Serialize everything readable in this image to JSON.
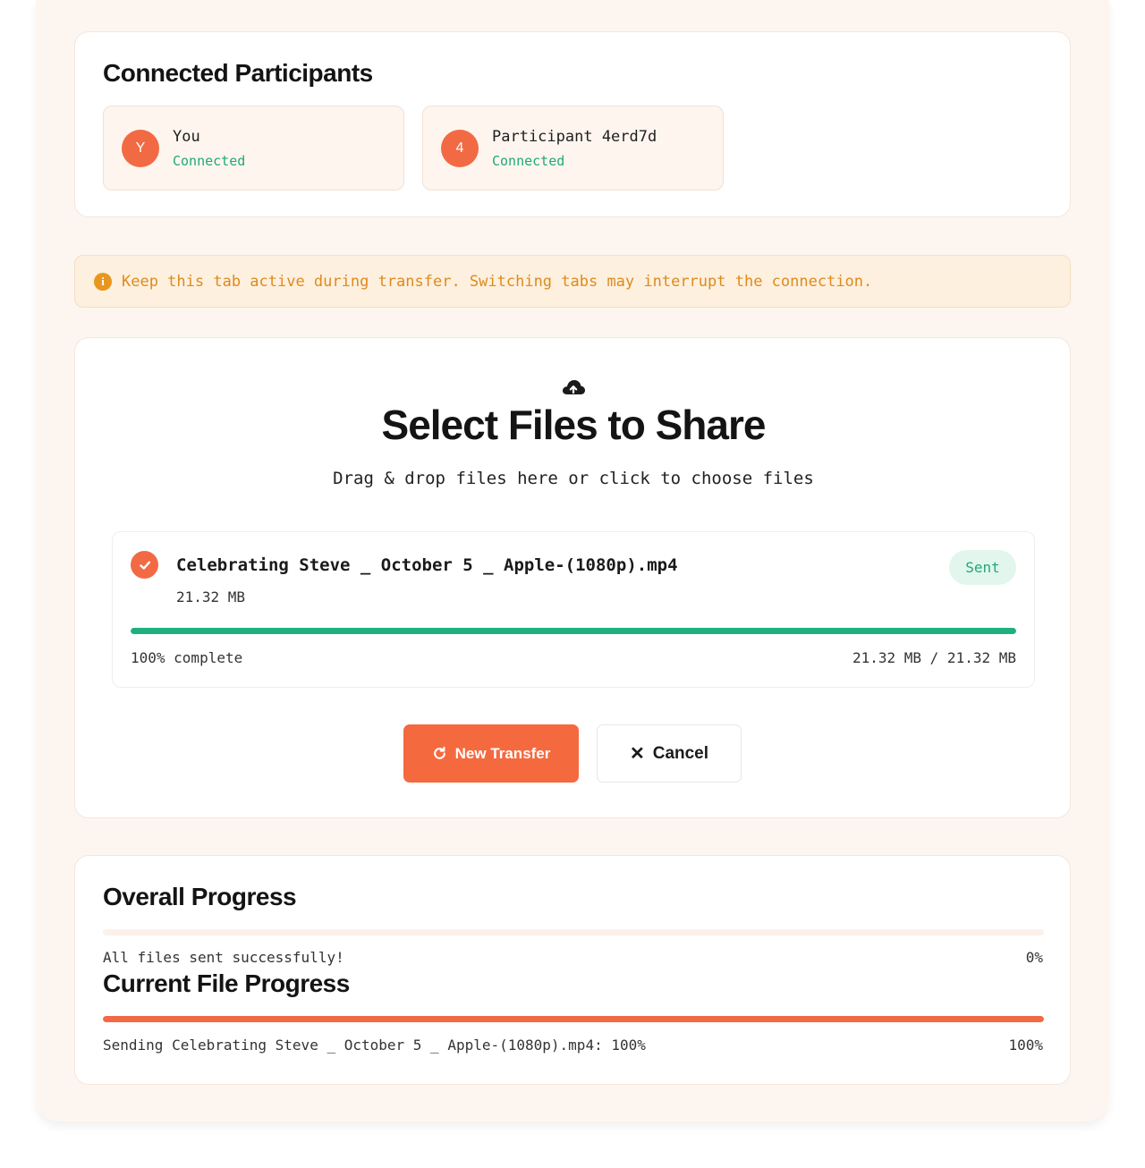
{
  "participants": {
    "title": "Connected Participants",
    "items": [
      {
        "initial": "Y",
        "name": "You",
        "status": "Connected"
      },
      {
        "initial": "4",
        "name": "Participant 4erd7d",
        "status": "Connected"
      }
    ]
  },
  "warning": {
    "icon": "info-icon",
    "text": "Keep this tab active during transfer. Switching tabs may interrupt the connection."
  },
  "select": {
    "icon": "cloud-upload-icon",
    "title": "Select Files to Share",
    "subtitle": "Drag & drop files here or click to choose files"
  },
  "file": {
    "name": "Celebrating Steve _ October 5 _ Apple-(1080p).mp4",
    "size": "21.32 MB",
    "badge": "Sent",
    "progress": 100,
    "percent_label": "100% complete",
    "bytes_label": "21.32 MB / 21.32 MB"
  },
  "actions": {
    "new_transfer_label": "New Transfer",
    "cancel_label": "Cancel"
  },
  "overall": {
    "title": "Overall Progress",
    "status": "All files sent successfully!",
    "percent_label": "0%",
    "progress": 0
  },
  "current": {
    "title": "Current File Progress",
    "status": "Sending Celebrating Steve _ October 5 _ Apple-(1080p).mp4: 100%",
    "percent_label": "100%",
    "progress": 100
  },
  "colors": {
    "accent": "#f26a44",
    "success": "#1fb07e",
    "warning": "#e8961e",
    "background": "#fdf6f0"
  }
}
